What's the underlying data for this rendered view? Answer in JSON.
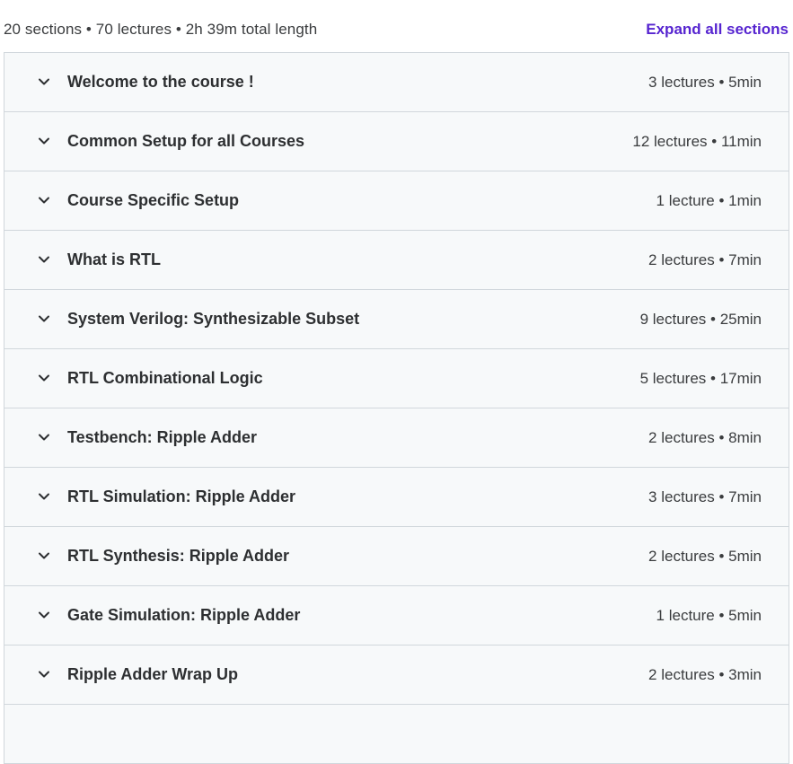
{
  "summary": {
    "text": "20 sections • 70 lectures • 2h 39m total length",
    "expand_label": "Expand all sections"
  },
  "colors": {
    "accent": "#5624d0",
    "row_bg": "#f7f9fa",
    "border": "#d1d7dc"
  },
  "sections": [
    {
      "title": "Welcome to the course !",
      "meta": "3 lectures • 5min",
      "icon": "chevron-down-icon"
    },
    {
      "title": "Common Setup for all Courses",
      "meta": "12 lectures • 11min",
      "icon": "chevron-down-icon"
    },
    {
      "title": "Course Specific Setup",
      "meta": "1 lecture • 1min",
      "icon": "chevron-down-icon"
    },
    {
      "title": "What is RTL",
      "meta": "2 lectures • 7min",
      "icon": "chevron-down-icon"
    },
    {
      "title": "System Verilog: Synthesizable Subset",
      "meta": "9 lectures • 25min",
      "icon": "chevron-down-icon"
    },
    {
      "title": "RTL Combinational Logic",
      "meta": "5 lectures • 17min",
      "icon": "chevron-down-icon"
    },
    {
      "title": "Testbench: Ripple Adder",
      "meta": "2 lectures • 8min",
      "icon": "chevron-down-icon"
    },
    {
      "title": "RTL Simulation: Ripple Adder",
      "meta": "3 lectures • 7min",
      "icon": "chevron-down-icon"
    },
    {
      "title": "RTL Synthesis: Ripple Adder",
      "meta": "2 lectures • 5min",
      "icon": "chevron-down-icon"
    },
    {
      "title": "Gate Simulation: Ripple Adder",
      "meta": "1 lecture • 5min",
      "icon": "chevron-down-icon"
    },
    {
      "title": "Ripple Adder Wrap Up",
      "meta": "2 lectures • 3min",
      "icon": "chevron-down-icon"
    }
  ]
}
